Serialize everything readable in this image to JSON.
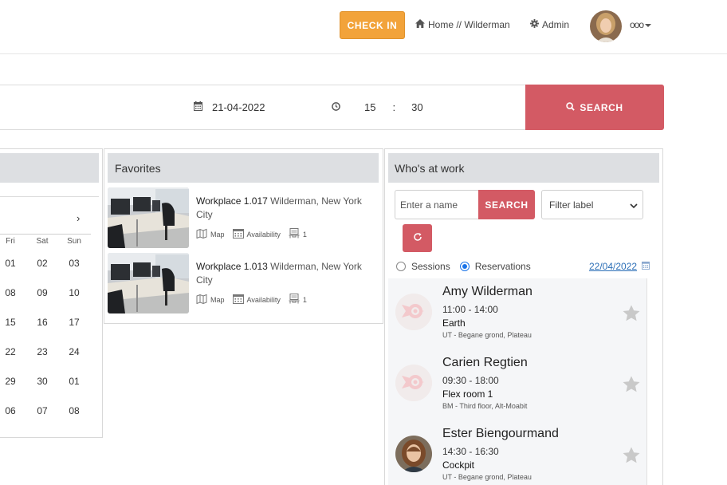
{
  "header": {
    "checkin_label": "CHECK IN",
    "breadcrumb": "Home // Wilderman",
    "admin_label": "Admin",
    "more_label": "ooo"
  },
  "search": {
    "date": "21-04-2022",
    "hour": "15",
    "separator": ":",
    "minute": "30",
    "button_label": "SEARCH"
  },
  "calendar": {
    "next_glyph": "›",
    "days": [
      "Fri",
      "Sat",
      "Sun"
    ],
    "rows": [
      [
        "01",
        "02",
        "03"
      ],
      [
        "08",
        "09",
        "10"
      ],
      [
        "15",
        "16",
        "17"
      ],
      [
        "22",
        "23",
        "24"
      ],
      [
        "29",
        "30",
        "01"
      ],
      [
        "06",
        "07",
        "08"
      ]
    ]
  },
  "favorites": {
    "title": "Favorites",
    "items": [
      {
        "workplace": "Workplace 1.017",
        "location": " Wilderman, New York City",
        "map_label": "Map",
        "availability_label": "Availability",
        "seats": "1"
      },
      {
        "workplace": "Workplace 1.013",
        "location": " Wilderman, New York City",
        "map_label": "Map",
        "availability_label": "Availability",
        "seats": "1"
      }
    ]
  },
  "whos_at_work": {
    "title": "Who's at work",
    "name_placeholder": "Enter a name",
    "search_label": "SEARCH",
    "filter_label": "Filter label",
    "sessions_label": "Sessions",
    "reservations_label": "Reservations",
    "date_link": "22/04/2022",
    "people": [
      {
        "name": "Amy Wilderman",
        "time": "11:00 - 14:00",
        "room": "Earth",
        "location": "UT - Begane grond, Plateau",
        "avatar": "default-logo"
      },
      {
        "name": "Carien Regtien",
        "time": "09:30 - 18:00",
        "room": "Flex room 1",
        "location": "BM - Third floor, Alt-Moabit",
        "avatar": "default-logo"
      },
      {
        "name": "Ester Biengourmand",
        "time": "14:30 - 16:30",
        "room": "Cockpit",
        "location": "UT - Begane grond, Plateau",
        "avatar": "photo"
      }
    ]
  },
  "colors": {
    "accent_red": "#d35a64",
    "checkin_orange": "#f2a33a",
    "panel_header": "#dddfe2",
    "link_blue": "#2c6fb7"
  }
}
